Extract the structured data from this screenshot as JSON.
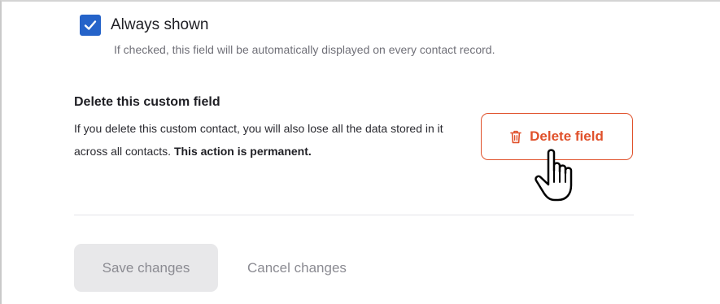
{
  "always_shown": {
    "label": "Always shown",
    "help_text": "If checked, this field will be automatically displayed on every contact record.",
    "checked": true,
    "check_icon": "checkmark-icon"
  },
  "delete_section": {
    "title": "Delete this custom field",
    "description": "If you delete this custom contact, you will also lose all the data stored in it across all contacts.",
    "description_emphasis": "This action is permanent.",
    "button_label": "Delete field",
    "button_icon": "trash-icon"
  },
  "footer": {
    "save_label": "Save changes",
    "cancel_label": "Cancel changes"
  },
  "colors": {
    "accent_blue": "#2563c9",
    "danger": "#e0512b",
    "disabled_bg": "#e8e8ea",
    "muted_text": "#8b8b92"
  }
}
